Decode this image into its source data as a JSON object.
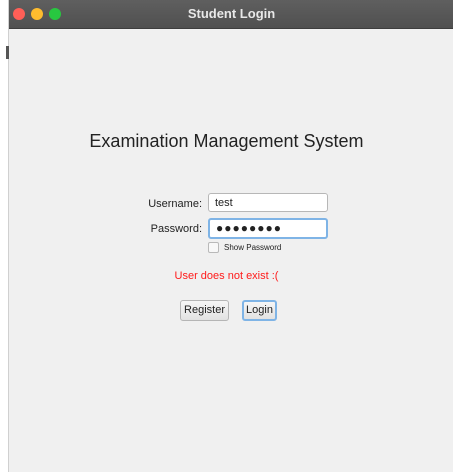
{
  "window": {
    "title": "Student Login"
  },
  "main": {
    "heading": "Examination Management System",
    "username_label": "Username:",
    "username_value": "test",
    "password_label": "Password:",
    "password_mask": "●●●●●●●●",
    "show_password_label": "Show Password",
    "error_message": "User does not exist :(",
    "register_label": "Register",
    "login_label": "Login"
  },
  "colors": {
    "error": "#ff1a1a",
    "focus_ring": "#7fb4e6"
  }
}
